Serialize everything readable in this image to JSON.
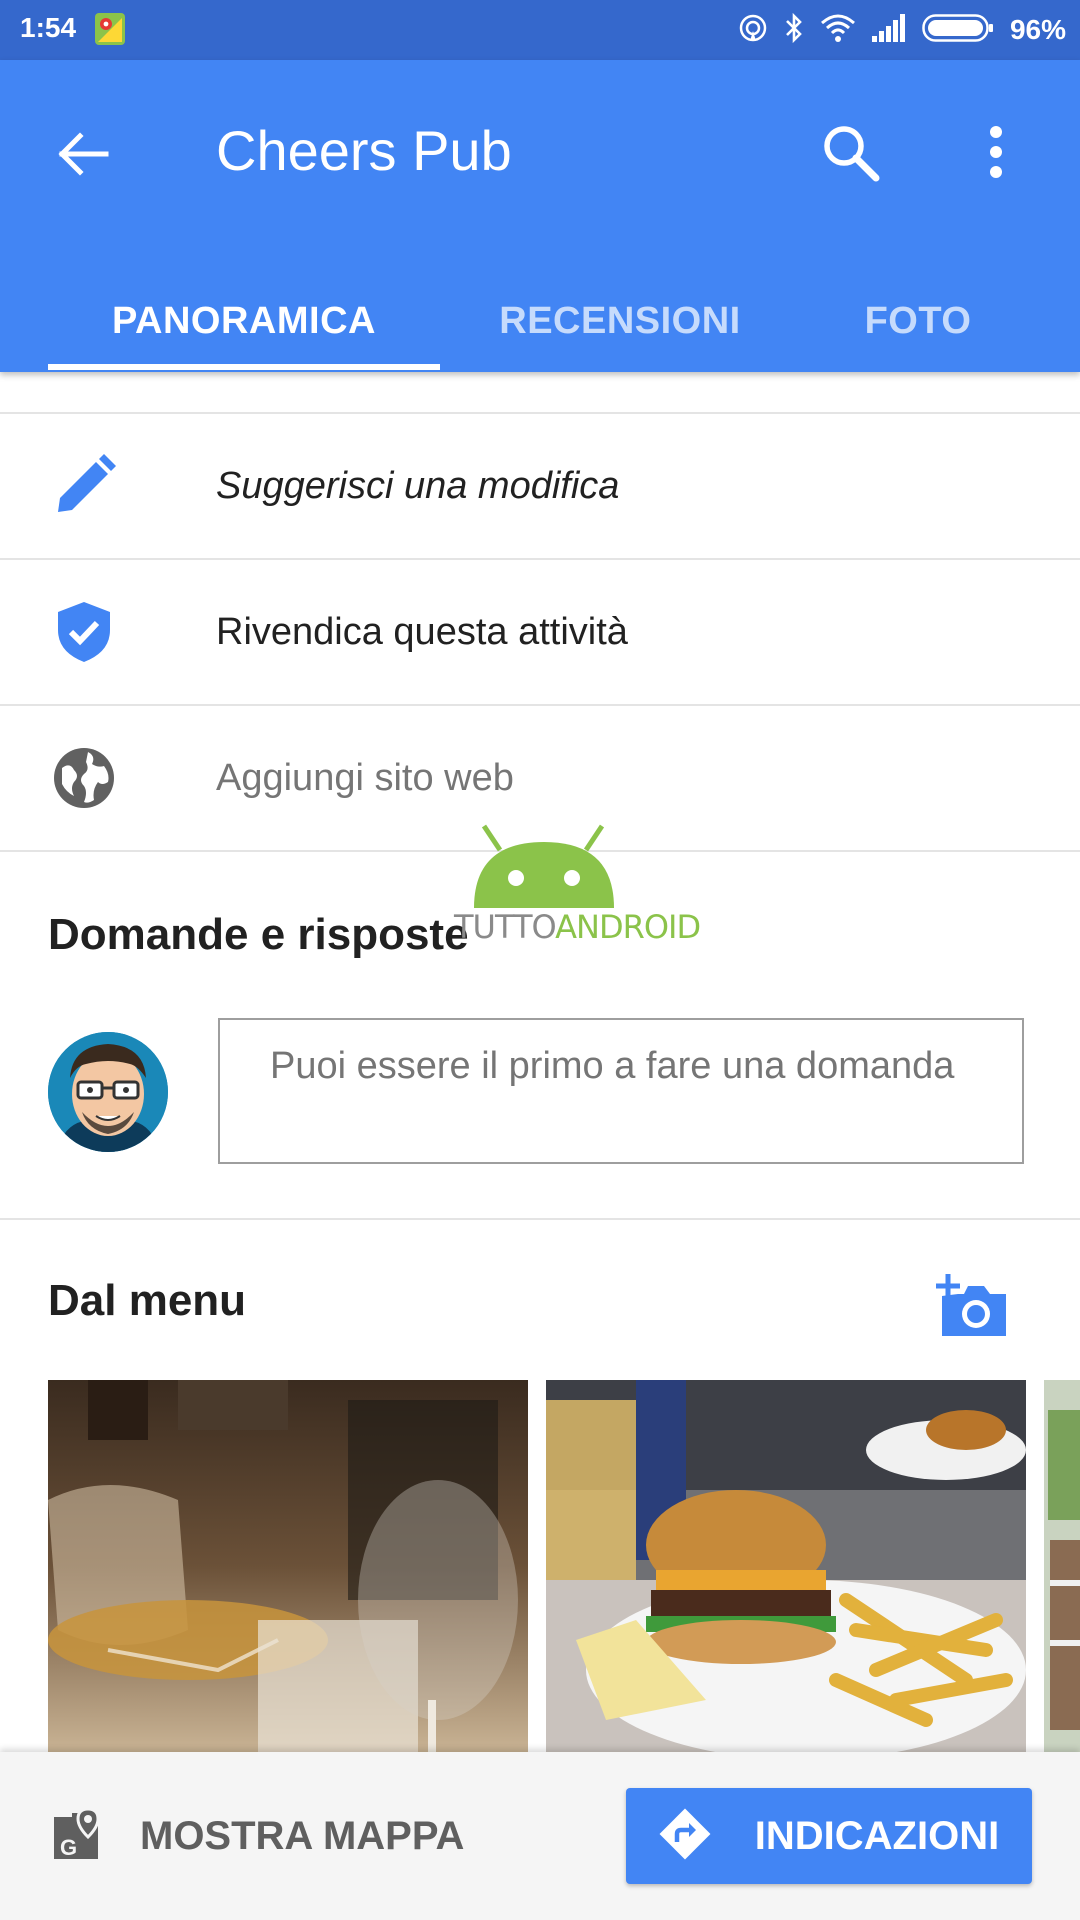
{
  "status_bar": {
    "time": "1:54",
    "battery_percent": "96%",
    "icons": [
      "maps-notification-icon",
      "hotspot-icon",
      "bluetooth-icon",
      "wifi-icon",
      "signal-icon",
      "battery-icon"
    ]
  },
  "app_bar": {
    "title": "Cheers Pub",
    "tabs": [
      {
        "label": "PANORAMICA",
        "active": true
      },
      {
        "label": "RECENSIONI",
        "active": false
      },
      {
        "label": "FOTO",
        "active": false
      }
    ]
  },
  "actions": [
    {
      "icon": "pencil-icon",
      "label": "Suggerisci una modifica"
    },
    {
      "icon": "verified-shield-icon",
      "label": "Rivendica questa attività"
    },
    {
      "icon": "globe-icon",
      "label": "Aggiungi sito web"
    }
  ],
  "qa": {
    "title": "Domande e risposte",
    "input_placeholder": "Puoi essere il primo a fare una domanda"
  },
  "menu": {
    "title": "Dal menu",
    "photos": [
      "glasses-photo",
      "burger-photo",
      "outdoor-photo"
    ]
  },
  "bottom_bar": {
    "map_label": "MOSTRA MAPPA",
    "directions_label": "INDICAZIONI"
  },
  "watermark": {
    "text_a": "TUTTO",
    "text_b": "ANDROID"
  },
  "colors": {
    "status_bar": "#3568cc",
    "app_bar": "#4285f4",
    "accent": "#4285f4",
    "watermark_green": "#8bc34a"
  }
}
